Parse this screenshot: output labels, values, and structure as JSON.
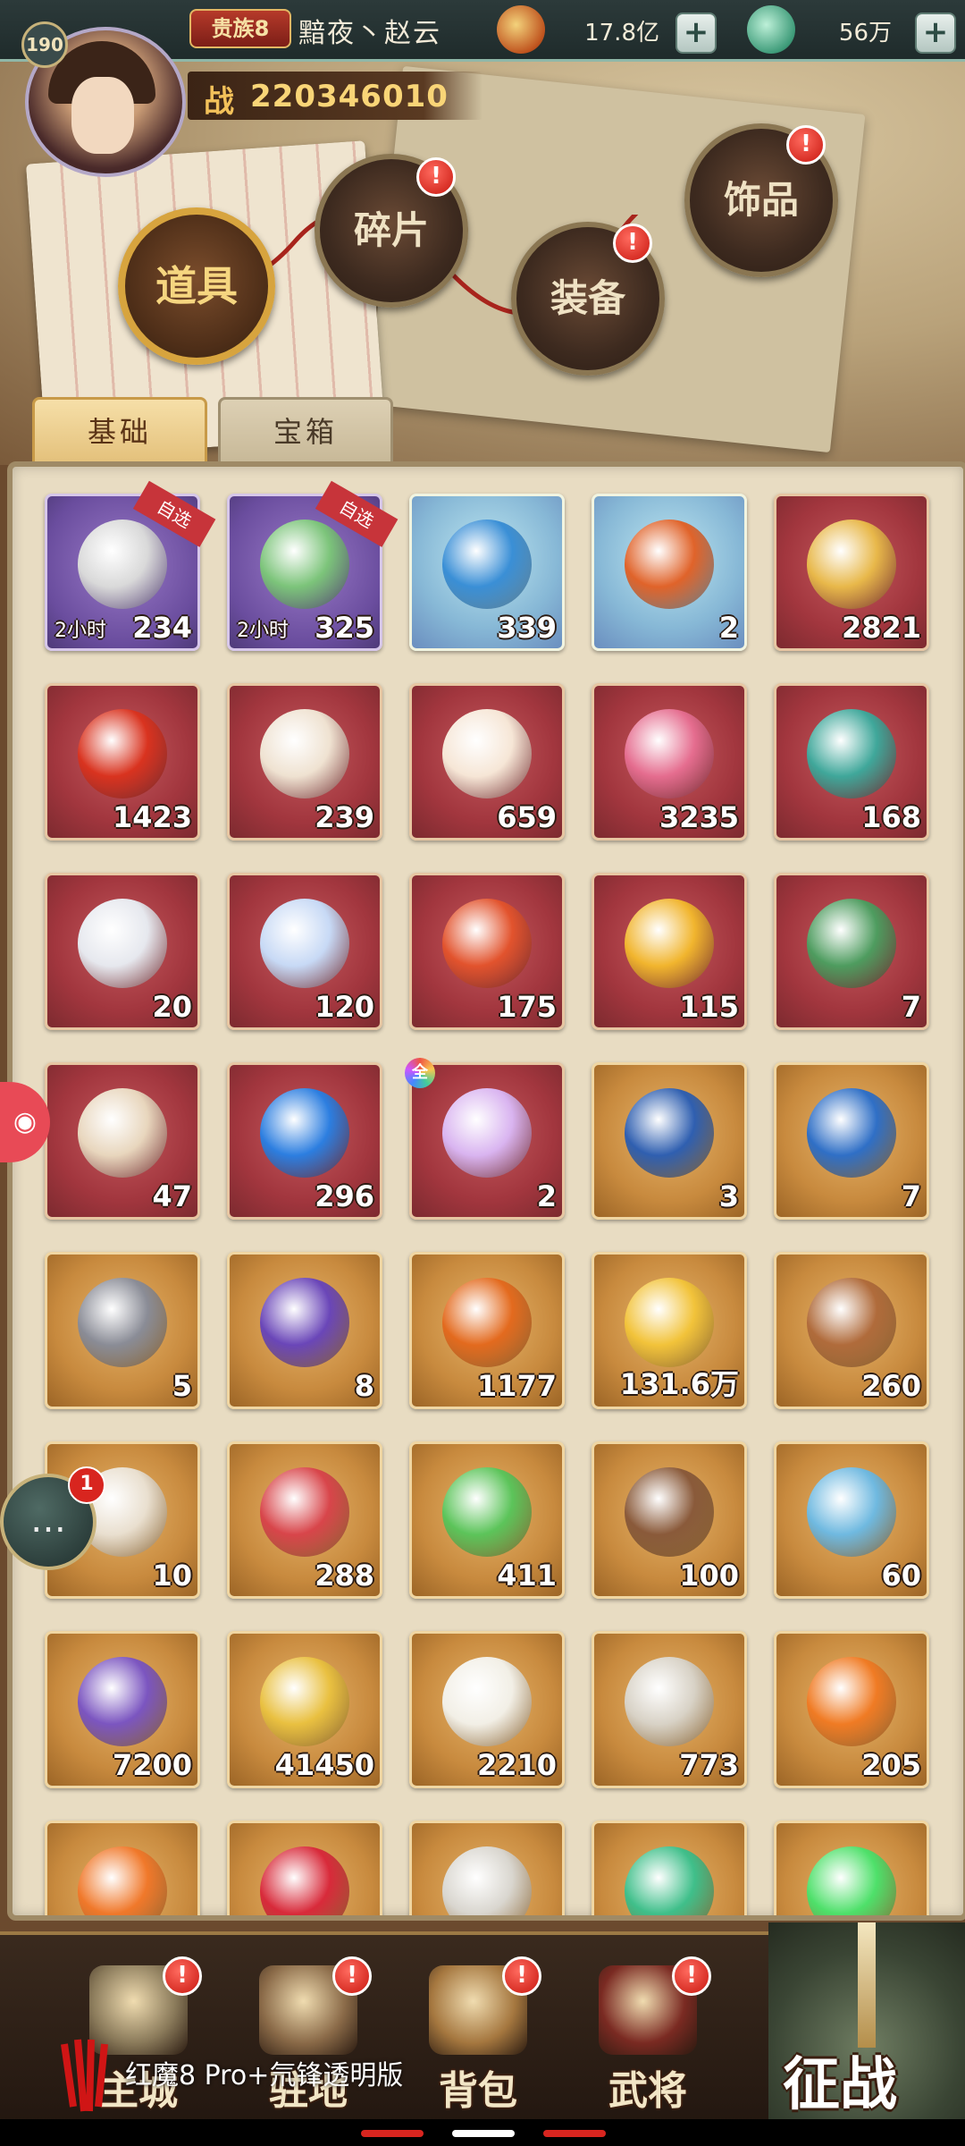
{
  "header": {
    "level": "190",
    "noble_rank": "贵族8",
    "player_name": "黯夜丶赵云",
    "currency_gold": "17.8亿",
    "currency_jade": "56万",
    "power_label": "战",
    "power_value": "220346010"
  },
  "categories": [
    {
      "label": "道具",
      "active": true,
      "badge": ""
    },
    {
      "label": "碎片",
      "active": false,
      "badge": "!"
    },
    {
      "label": "装备",
      "active": false,
      "badge": "!"
    },
    {
      "label": "饰品",
      "active": false,
      "badge": "!"
    }
  ],
  "tabs": [
    {
      "label": "基础",
      "active": true
    },
    {
      "label": "宝箱",
      "active": false
    }
  ],
  "items": [
    {
      "qty": "234",
      "frame": "purple",
      "duration": "2小时",
      "ribbon": "自选",
      "icon": "sundial-clock-icon",
      "art": "#d9d9d9"
    },
    {
      "qty": "325",
      "frame": "purple",
      "duration": "2小时",
      "ribbon": "自选",
      "icon": "sundial-clock-green-icon",
      "art": "#7cc47a"
    },
    {
      "qty": "339",
      "frame": "cyan",
      "duration": "",
      "ribbon": "",
      "icon": "blue-orb-ornament-icon",
      "art": "#3a8fd6"
    },
    {
      "qty": "2",
      "frame": "cyan",
      "duration": "",
      "ribbon": "",
      "icon": "fire-gem-ornament-icon",
      "art": "#e0632a"
    },
    {
      "qty": "2821",
      "frame": "red",
      "duration": "",
      "ribbon": "",
      "icon": "dragon-coin-icon",
      "art": "#e8b84a"
    },
    {
      "qty": "1423",
      "frame": "red",
      "duration": "",
      "ribbon": "",
      "icon": "red-dragon-envelope-icon",
      "art": "#d9331f"
    },
    {
      "qty": "239",
      "frame": "red",
      "duration": "",
      "ribbon": "",
      "icon": "horn-scroll-icon",
      "art": "#efe2d1"
    },
    {
      "qty": "659",
      "frame": "red",
      "duration": "",
      "ribbon": "",
      "icon": "seashell-icon",
      "art": "#f6e6d6"
    },
    {
      "qty": "3235",
      "frame": "red",
      "duration": "",
      "ribbon": "",
      "icon": "crystal-beast-icon",
      "art": "#e56d8f"
    },
    {
      "qty": "168",
      "frame": "red",
      "duration": "",
      "ribbon": "",
      "icon": "jade-book-icon",
      "art": "#3fa79a"
    },
    {
      "qty": "20",
      "frame": "red",
      "duration": "",
      "ribbon": "",
      "icon": "scroll-icon",
      "art": "#e6e8ee"
    },
    {
      "qty": "120",
      "frame": "red",
      "duration": "",
      "ribbon": "",
      "icon": "prism-crystal-icon",
      "art": "#c7d9f5"
    },
    {
      "qty": "175",
      "frame": "red",
      "duration": "",
      "ribbon": "",
      "icon": "red-gourd-icon",
      "art": "#e2532d"
    },
    {
      "qty": "115",
      "frame": "red",
      "duration": "",
      "ribbon": "",
      "icon": "gold-gourd-icon",
      "art": "#f1b52e"
    },
    {
      "qty": "7",
      "frame": "red",
      "duration": "",
      "ribbon": "",
      "icon": "green-book-icon",
      "art": "#4e9c5f"
    },
    {
      "qty": "47",
      "frame": "red",
      "duration": "",
      "ribbon": "",
      "icon": "talisman-card-icon",
      "art": "#e8d6bd"
    },
    {
      "qty": "296",
      "frame": "red",
      "duration": "",
      "ribbon": "",
      "icon": "blue-pearl-stand-icon",
      "art": "#2c7ee0"
    },
    {
      "qty": "2",
      "frame": "red",
      "duration": "",
      "ribbon": "",
      "icon": "rainbow-pearl-icon",
      "art": "#d9b4f0",
      "all_badge": "全"
    },
    {
      "qty": "3",
      "frame": "gold",
      "duration": "",
      "ribbon": "",
      "icon": "blue-banner-icon",
      "art": "#2f5fb0"
    },
    {
      "qty": "7",
      "frame": "gold",
      "duration": "",
      "ribbon": "",
      "icon": "blue-banner-icon",
      "art": "#2f6fc6"
    },
    {
      "qty": "5",
      "frame": "gold",
      "duration": "",
      "ribbon": "",
      "icon": "grey-banner-icon",
      "art": "#8a8c96"
    },
    {
      "qty": "8",
      "frame": "gold",
      "duration": "",
      "ribbon": "",
      "icon": "purple-banner-icon",
      "art": "#6a46b8"
    },
    {
      "qty": "1177",
      "frame": "gold",
      "duration": "",
      "ribbon": "",
      "icon": "orange-token-icon",
      "art": "#e36a1e"
    },
    {
      "qty": "131.6万",
      "frame": "gold",
      "duration": "",
      "ribbon": "",
      "icon": "gold-orb-chest-icon",
      "art": "#f2c33a"
    },
    {
      "qty": "260",
      "frame": "gold",
      "duration": "",
      "ribbon": "",
      "icon": "crossed-arrows-icon",
      "art": "#b06b3b"
    },
    {
      "qty": "10",
      "frame": "gold",
      "duration": "",
      "ribbon": "",
      "icon": "yin-yang-mirror-icon",
      "art": "#e9dfcf"
    },
    {
      "qty": "288",
      "frame": "gold",
      "duration": "",
      "ribbon": "",
      "icon": "red-ore-icon",
      "art": "#d8454a"
    },
    {
      "qty": "411",
      "frame": "gold",
      "duration": "",
      "ribbon": "",
      "icon": "green-crystal-icon",
      "art": "#5cc45a"
    },
    {
      "qty": "100",
      "frame": "gold",
      "duration": "",
      "ribbon": "",
      "icon": "wood-token-icon",
      "art": "#8a5a3a"
    },
    {
      "qty": "60",
      "frame": "gold",
      "duration": "",
      "ribbon": "",
      "icon": "ice-fish-icon",
      "art": "#6fb9e0"
    },
    {
      "qty": "7200",
      "frame": "gold",
      "duration": "",
      "ribbon": "",
      "icon": "purple-cloth-icon",
      "art": "#7b55c0"
    },
    {
      "qty": "41450",
      "frame": "gold",
      "duration": "",
      "ribbon": "",
      "icon": "gold-coin-icon",
      "art": "#e9c040"
    },
    {
      "qty": "2210",
      "frame": "gold",
      "duration": "",
      "ribbon": "",
      "icon": "dragon-vase-icon",
      "art": "#f2efe6"
    },
    {
      "qty": "773",
      "frame": "gold",
      "duration": "",
      "ribbon": "",
      "icon": "silver-coin-icon",
      "art": "#d8d2c6"
    },
    {
      "qty": "205",
      "frame": "gold",
      "duration": "",
      "ribbon": "",
      "icon": "fire-orb-icon",
      "art": "#f07b24"
    },
    {
      "qty": "",
      "frame": "gold",
      "duration": "",
      "ribbon": "",
      "icon": "fire-gem-icon",
      "art": "#f0782a"
    },
    {
      "qty": "",
      "frame": "gold",
      "duration": "",
      "ribbon": "",
      "icon": "ruby-icon",
      "art": "#d82a3a"
    },
    {
      "qty": "",
      "frame": "gold",
      "duration": "",
      "ribbon": "",
      "icon": "stone-tablet-icon",
      "art": "#d9d6cf"
    },
    {
      "qty": "",
      "frame": "gold",
      "duration": "",
      "ribbon": "",
      "icon": "jade-knot-icon",
      "art": "#3fbf8a"
    },
    {
      "qty": "",
      "frame": "gold",
      "duration": "",
      "ribbon": "",
      "icon": "green-flame-icon",
      "art": "#4ee06a"
    }
  ],
  "chat": {
    "badge": "1"
  },
  "nav": [
    {
      "label": "主城",
      "badge": "!",
      "icon": "city-icon",
      "art": "#8a7a5a"
    },
    {
      "label": "驻地",
      "badge": "!",
      "icon": "camp-icon",
      "art": "#8a6a48"
    },
    {
      "label": "背包",
      "badge": "!",
      "icon": "bag-chest-icon",
      "art": "#a5773f"
    },
    {
      "label": "武将",
      "badge": "!",
      "icon": "general-helmet-icon",
      "art": "#7a2a22"
    }
  ],
  "battle": {
    "label": "征战"
  },
  "watermark": "红魔8 Pro+氘锋透明版",
  "colors": {
    "accent_gold": "#d7a43e",
    "badge_red": "#d8251f"
  }
}
